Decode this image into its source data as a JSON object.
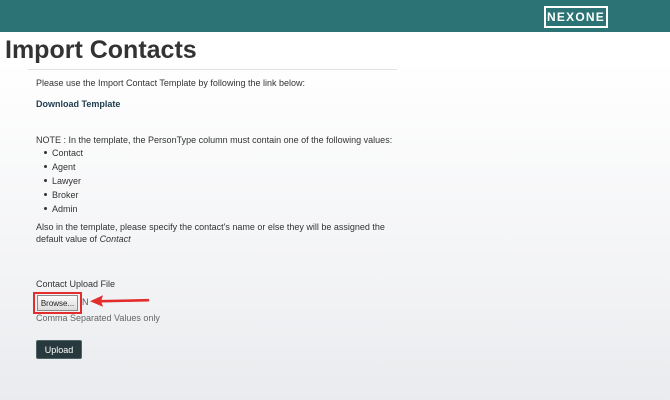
{
  "header": {
    "logo_text": "NEXONE",
    "bar_color": "#2b7374"
  },
  "page": {
    "title": "Import Contacts"
  },
  "content": {
    "intro": "Please use the Import Contact Template by following the link below:",
    "download_link": "Download Template",
    "note": "NOTE : In the template, the PersonType column must contain one of the following values:",
    "person_types": [
      "Contact",
      "Agent",
      "Lawyer",
      "Broker",
      "Admin"
    ],
    "also_prefix": "Also in the template, please specify the contact's name or else they will be assigned the default value of",
    "also_default": "Contact"
  },
  "form": {
    "upload_label": "Contact Upload File",
    "browse_label": "Browse...",
    "file_name": "N",
    "hint": "Comma Separated Values only",
    "upload_button": "Upload"
  },
  "annotation": {
    "highlight_color": "#e32c2c",
    "arrow_icon": "arrow-left-icon"
  }
}
